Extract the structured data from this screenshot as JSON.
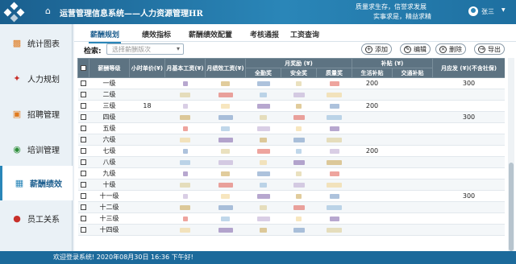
{
  "header": {
    "app_title": "运营管理信息系统——人力资源管理HR",
    "motto_line1": "质量求生存，信誉求发展",
    "motto_line2": "实事求是，精益求精",
    "user_name": "张三",
    "brand_color": "#2a86b8"
  },
  "sidebar": {
    "items": [
      {
        "label": "统计图表",
        "icon": "bar-chart-icon",
        "active": false
      },
      {
        "label": "人力规划",
        "icon": "person-plan-icon",
        "active": false
      },
      {
        "label": "招聘管理",
        "icon": "recruit-icon",
        "active": false
      },
      {
        "label": "培训管理",
        "icon": "training-icon",
        "active": false
      },
      {
        "label": "薪酬绩效",
        "icon": "salary-icon",
        "active": true
      },
      {
        "label": "员工关系",
        "icon": "relations-icon",
        "active": false
      }
    ]
  },
  "tabs": [
    "薪酬规划",
    "绩效指标",
    "薪酬绩效配置",
    "考核通报",
    "工资查询"
  ],
  "search": {
    "label": "检索:",
    "placeholder": "选择薪酬版次"
  },
  "toolbar": {
    "add": "添加",
    "edit": "编辑",
    "delete": "删除",
    "export": "导出"
  },
  "table": {
    "header_row1": [
      "薪酬等级",
      "小时单价(¥)",
      "月基本工资(¥)",
      "月绩效工资(¥)",
      "月奖励 (¥)",
      "补贴 (¥)",
      "月应发 (¥)(不含社保)"
    ],
    "award_sub": [
      "全勤奖",
      "安全奖",
      "质量奖"
    ],
    "subsidy_sub": [
      "生活补贴",
      "交通补贴"
    ],
    "rows": [
      {
        "grade": "一级",
        "price": "",
        "sub1": "",
        "total": ""
      },
      {
        "grade": "二级",
        "price": "",
        "sub1": "",
        "total": ""
      },
      {
        "grade": "三级",
        "price": "18",
        "sub1": "",
        "total": ""
      },
      {
        "grade": "四级",
        "price": "",
        "sub1": "",
        "total": ""
      },
      {
        "grade": "五级",
        "price": "",
        "sub1": "",
        "total": ""
      },
      {
        "grade": "六级",
        "price": "",
        "sub1": "",
        "total": ""
      },
      {
        "grade": "七级",
        "price": "",
        "sub1": "",
        "total": ""
      },
      {
        "grade": "八级",
        "price": "",
        "sub1": "",
        "total": ""
      },
      {
        "grade": "九级",
        "price": "",
        "sub1": "",
        "total": ""
      },
      {
        "grade": "十级",
        "price": "",
        "sub1": "",
        "total": ""
      },
      {
        "grade": "十一级",
        "price": "",
        "sub1": "",
        "total": ""
      },
      {
        "grade": "十二级",
        "price": "",
        "sub1": "",
        "total": ""
      },
      {
        "grade": "十三级",
        "price": "",
        "sub1": "",
        "total": ""
      },
      {
        "grade": "十四级",
        "price": "",
        "sub1": "",
        "total": ""
      }
    ],
    "subsidy_value": "200",
    "total_value": "300"
  },
  "footer": {
    "text": "欢迎登录系统! 2020年08月30日 16:36 下午好!"
  }
}
